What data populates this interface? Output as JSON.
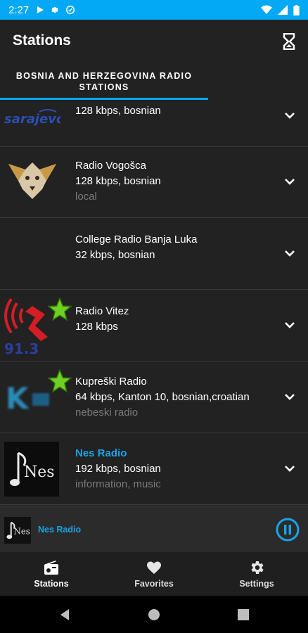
{
  "status_bar": {
    "time": "2:27",
    "icons_left": [
      "play-icon",
      "gear-icon",
      "sync-icon"
    ],
    "icons_right": [
      "wifi-icon",
      "signal-icon",
      "battery-icon"
    ],
    "color": "#03A9F4"
  },
  "app_bar": {
    "title": "Stations",
    "action_icon": "hourglass-icon",
    "tab_label": "BOSNIA AND HERZEGOVINA RADIO STATIONS"
  },
  "stations": [
    {
      "name": "",
      "meta": "128 kbps, bosnian",
      "tags": "",
      "favorite": false,
      "playing": false
    },
    {
      "name": "Radio Vogošca",
      "meta": "128 kbps, bosnian",
      "tags": "local",
      "favorite": false,
      "playing": false
    },
    {
      "name": "College Radio Banja Luka",
      "meta": "32 kbps, bosnian",
      "tags": "",
      "favorite": false,
      "playing": false
    },
    {
      "name": "Radio Vitez",
      "meta": "128 kbps",
      "tags": "",
      "favorite": true,
      "playing": false
    },
    {
      "name": "Kupreški Radio",
      "meta": "64 kbps, Kanton 10, bosnian,croatian",
      "tags": "nebeski radio",
      "favorite": true,
      "playing": false
    },
    {
      "name": "Nes Radio",
      "meta": "192 kbps, bosnian",
      "tags": "information, music",
      "favorite": false,
      "playing": true
    }
  ],
  "logos": {
    "row0": "sarajevo-logo",
    "row1": "vogosca-logo",
    "row3": "vitez-logo",
    "row3_text": "91.3",
    "row4": "kupreski-logo",
    "row4_text": "K",
    "row5": "nes-logo",
    "row5_text": "Nes"
  },
  "player": {
    "station_name": "Nes Radio",
    "state_icon": "pause-icon"
  },
  "bottom_nav": [
    {
      "label": "Stations",
      "icon": "radio-icon",
      "active": true
    },
    {
      "label": "Favorites",
      "icon": "heart-icon",
      "active": false
    },
    {
      "label": "Settings",
      "icon": "gear-icon",
      "active": false
    }
  ],
  "colors": {
    "accent": "#03A9F4",
    "playing_text": "#1aa3e8",
    "favorite_star": "#6fcf23",
    "background": "#222222"
  }
}
